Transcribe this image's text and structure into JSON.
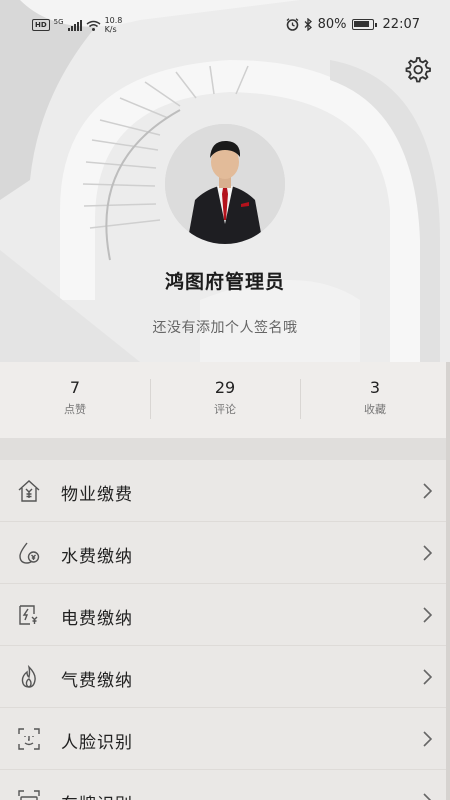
{
  "status_bar": {
    "hd": "HD",
    "network": "5G",
    "speed_value": "10.8",
    "speed_unit": "K/s",
    "battery": "80%",
    "time": "22:07"
  },
  "profile": {
    "name": "鸿图府管理员",
    "signature": "还没有添加个人签名哦"
  },
  "stats": [
    {
      "value": "7",
      "label": "点赞"
    },
    {
      "value": "29",
      "label": "评论"
    },
    {
      "value": "3",
      "label": "收藏"
    }
  ],
  "menu": [
    {
      "label": "物业缴费",
      "icon": "property-fee-icon"
    },
    {
      "label": "水费缴纳",
      "icon": "water-fee-icon"
    },
    {
      "label": "电费缴纳",
      "icon": "electric-fee-icon"
    },
    {
      "label": "气费缴纳",
      "icon": "gas-fee-icon"
    },
    {
      "label": "人脸识别",
      "icon": "face-recognition-icon"
    },
    {
      "label": "车牌识别",
      "icon": "plate-recognition-icon"
    }
  ]
}
